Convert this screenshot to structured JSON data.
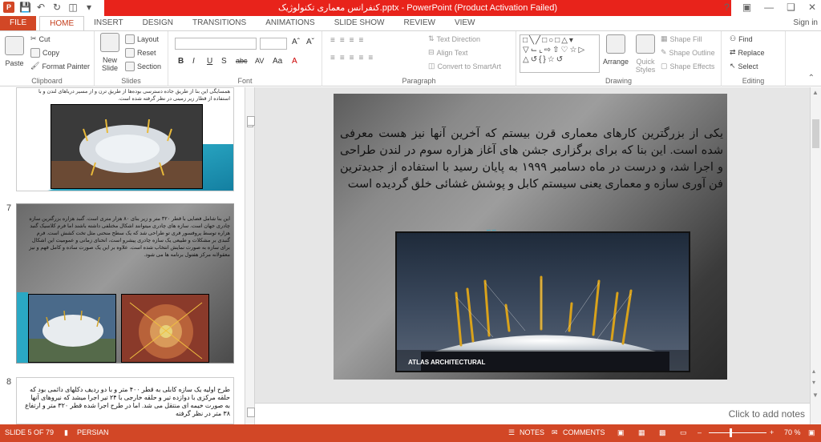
{
  "title": "کنفرانس معماری تکنولوژیک.pptx - PowerPoint (Product Activation Failed)",
  "tabs": [
    "FILE",
    "HOME",
    "INSERT",
    "DESIGN",
    "TRANSITIONS",
    "ANIMATIONS",
    "SLIDE SHOW",
    "REVIEW",
    "VIEW"
  ],
  "sign_in": "Sign in",
  "ribbon": {
    "clipboard": {
      "label": "Clipboard",
      "paste": "Paste",
      "cut": "Cut",
      "copy": "Copy",
      "format_painter": "Format Painter"
    },
    "slides": {
      "label": "Slides",
      "new_slide": "New Slide",
      "layout": "Layout",
      "reset": "Reset",
      "section": "Section"
    },
    "font": {
      "label": "Font",
      "buttons": [
        "B",
        "I",
        "U",
        "S",
        "abc",
        "AV",
        "Aa",
        "A"
      ]
    },
    "paragraph": {
      "label": "Paragraph",
      "text_direction": "Text Direction",
      "align_text": "Align Text",
      "convert_smartart": "Convert to SmartArt"
    },
    "drawing": {
      "label": "Drawing",
      "arrange": "Arrange",
      "quick_styles": "Quick Styles",
      "shape_fill": "Shape Fill",
      "shape_outline": "Shape Outline",
      "shape_effects": "Shape Effects"
    },
    "editing": {
      "label": "Editing",
      "find": "Find",
      "replace": "Replace",
      "select": "Select"
    }
  },
  "thumbnails": [
    {
      "number": "",
      "text": "همسایگی این بنا از طریق جاده دسترسی بوده‌ها از طریق ترن و از مسیر دریاهای لندن و با استفاده از قطار زیر زمینی در نظر گرفته شده است."
    },
    {
      "number": "7",
      "text": "این بنا شامل فضایی با قطر ۳۲۰ متر و زیر بنای ۸۰ هزار متری است. گنبد هزاره بزرگترین سازه چادری جهان است. سازه های چادری میتوانند اشکال مختلفی داشته باشند اما فرم کلاسیک گنبد هزاره توسط پروفسور فری تو طراحی شد که یک سطح منحنی مثل تخت کشش است. فرم گنبدی بر مشکلات و طبیعی یک سازه چادری پیشرو است، انحنای زمانی و عمومیت این اشکال برای سازه به صورت نمایش انتخاب شده است. علاوه بر این یک صورت ساده و کامل فهم و نیز معقولانه مرکز هفتول برنامه ها می شود."
    },
    {
      "number": "8",
      "text": "طرح اولیه یک سازه کابلی به قطر ۴۰۰ متر و با دو ردیف دکلهای دائمی بود که حلقه مرکزی با دوازده تیر و حلقه خارجی با ۲۴ تیر اجرا میشد که نیروهای آنها به صورت خیمه ای منتقل می شد. اما در طرح اجرا شده قطر ۳۲۰ متر و ارتفاع ۳۸ متر در نظر گرفته"
    }
  ],
  "slide": {
    "body": "یکی از بزرگترین کارهای معماری قرن بیستم که آخرین آنها نیز هست معرفی شده است. این بنا که برای برگزاری جشن های آغاز هزاره سوم در لندن طراحی و اجرا شد، و درست در ماه دسامبر ۱۹۹۹ به پایان رسید با استفاده از جدیدترین فن آوری سازه و معماری یعنی سیستم کابل و پوشش غشائی خلق گردیده است",
    "photo_watermark": "ATLAS ARCHITECTURAL"
  },
  "notes_placeholder": "Click to add notes",
  "status": {
    "slide": "SLIDE 5 OF 79",
    "language": "PERSIAN",
    "notes": "NOTES",
    "comments": "COMMENTS",
    "zoom": "70 %"
  },
  "colors": {
    "accent": "#d24726",
    "title_bar": "#e8231b"
  }
}
